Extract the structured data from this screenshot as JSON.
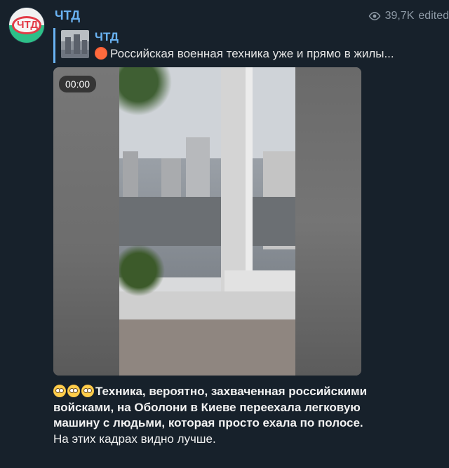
{
  "channel": {
    "name": "ЧТД",
    "avatar_text": "ЧТД"
  },
  "meta": {
    "views": "39,7K",
    "status": "edited"
  },
  "reply": {
    "title": "ЧТД",
    "text": "Российская военная техника уже и прямо в жилы..."
  },
  "video": {
    "duration": "00:00"
  },
  "caption": {
    "bold": "Техника, вероятно, захваченная российскими войсками, на Оболони в Киеве переехала легковую машину с людьми, которая просто ехала по полосе.",
    "normal": " На этих кадрах видно лучше."
  },
  "colors": {
    "background": "#17212b",
    "accent": "#6ab3f3",
    "muted": "#8e9aa6"
  },
  "icons": {
    "views": "eye-icon",
    "reply_emoji": "angry-face-icon",
    "caption_emoji": "flushed-face-icon"
  }
}
